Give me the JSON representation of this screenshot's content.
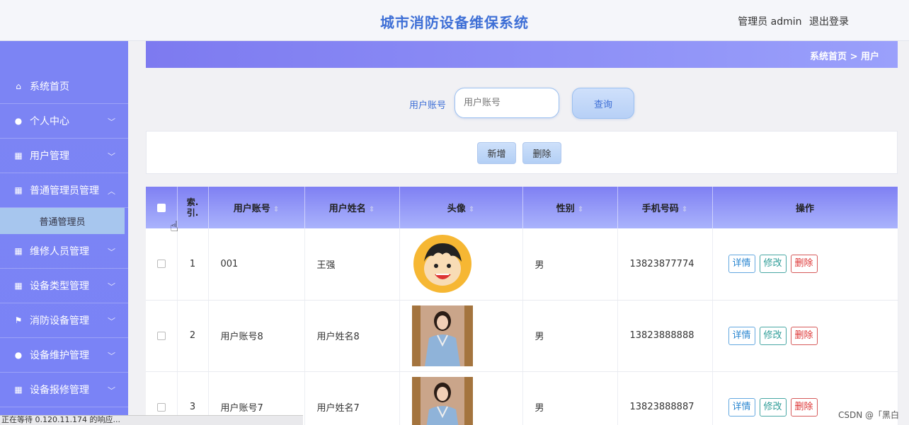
{
  "header": {
    "title": "城市消防设备维保系统",
    "user_label": "管理员 admin",
    "logout_label": "退出登录"
  },
  "sidebar": {
    "items": [
      {
        "label": "系统首页",
        "icon": "home-icon",
        "expandable": false
      },
      {
        "label": "个人中心",
        "icon": "person-icon",
        "expandable": true
      },
      {
        "label": "用户管理",
        "icon": "grid-icon",
        "expandable": true
      },
      {
        "label": "普通管理员管理",
        "icon": "grid-icon",
        "expandable": true,
        "expanded": true
      },
      {
        "label": "维修人员管理",
        "icon": "grid-icon",
        "expandable": true
      },
      {
        "label": "设备类型管理",
        "icon": "grid-icon",
        "expandable": true
      },
      {
        "label": "消防设备管理",
        "icon": "flag-icon",
        "expandable": true
      },
      {
        "label": "设备维护管理",
        "icon": "person-icon",
        "expandable": true
      },
      {
        "label": "设备报修管理",
        "icon": "grid-icon",
        "expandable": true
      }
    ],
    "sub_item": "普通管理员"
  },
  "breadcrumb": "系统首页 > 用户",
  "search": {
    "label": "用户账号",
    "placeholder": "用户账号",
    "button": "查询"
  },
  "actions": {
    "add": "新增",
    "delete": "删除"
  },
  "table": {
    "columns": [
      "索引",
      "用户账号",
      "用户姓名",
      "头像",
      "性别",
      "手机号码",
      "操作"
    ],
    "index_head_line1": "索.",
    "index_head_line2": "引.",
    "rows": [
      {
        "index": "1",
        "account": "001",
        "name": "王强",
        "avatar": "cartoon-avatar",
        "gender": "男",
        "phone": "13823877774"
      },
      {
        "index": "2",
        "account": "用户账号8",
        "name": "用户姓名8",
        "avatar": "photo-avatar",
        "gender": "男",
        "phone": "13823888888"
      },
      {
        "index": "3",
        "account": "用户账号7",
        "name": "用户姓名7",
        "avatar": "photo-avatar",
        "gender": "男",
        "phone": "13823888887"
      }
    ],
    "ops": {
      "detail": "详情",
      "edit": "修改",
      "delete": "删除"
    }
  },
  "statusbar": "正在等待 0.120.11.174 的响应...",
  "watermark": "CSDN @「黑白",
  "colors": {
    "accent": "#7c84f4",
    "title": "#3e6fd6"
  }
}
